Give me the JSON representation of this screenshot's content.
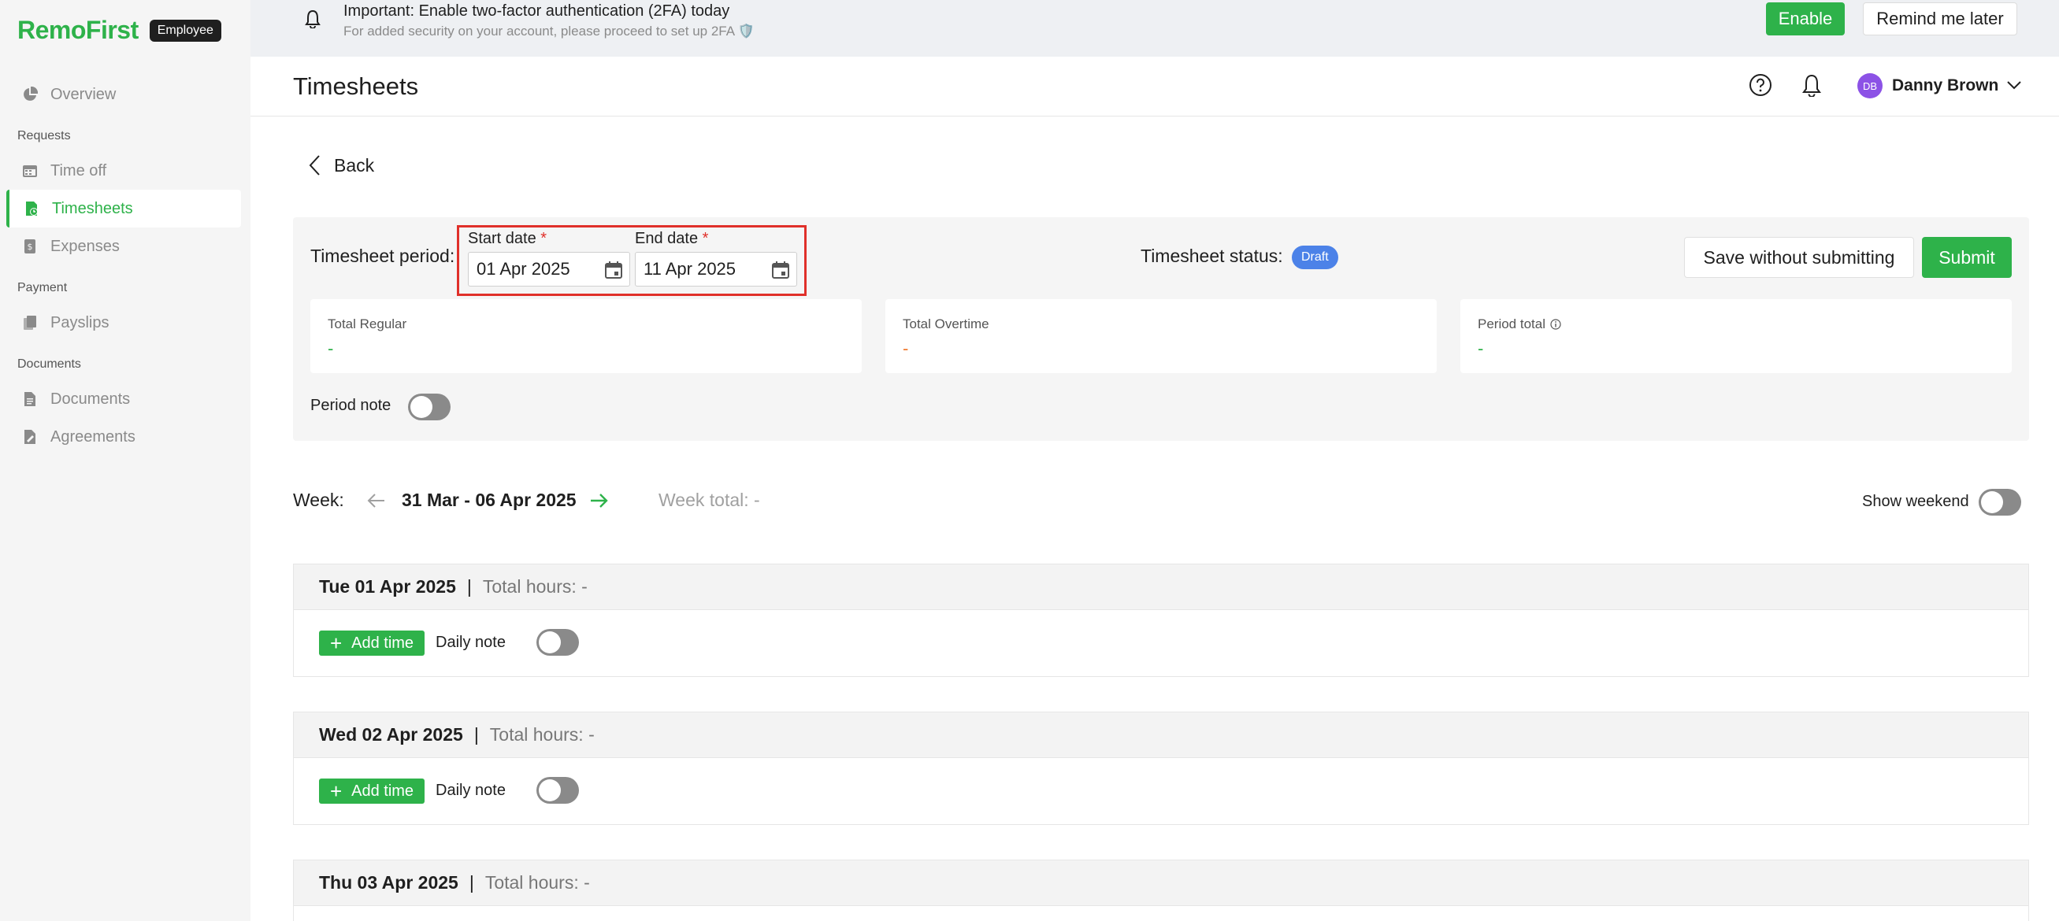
{
  "sidebar": {
    "logo": "RemoFirst",
    "badge": "Employee",
    "items": [
      {
        "label": "Overview"
      },
      {
        "section": "Requests"
      },
      {
        "label": "Time off"
      },
      {
        "label": "Timesheets",
        "active": true
      },
      {
        "label": "Expenses"
      },
      {
        "section": "Payment"
      },
      {
        "label": "Payslips"
      },
      {
        "section": "Documents"
      },
      {
        "label": "Documents"
      },
      {
        "label": "Agreements"
      }
    ]
  },
  "banner": {
    "title": "Important: Enable two-factor authentication (2FA) today",
    "subtitle": "For added security on your account, please proceed to set up 2FA 🛡️",
    "enable_label": "Enable",
    "remind_label": "Remind me later"
  },
  "header": {
    "title": "Timesheets",
    "avatar_initials": "DB",
    "user_name": "Danny Brown"
  },
  "back_label": "Back",
  "period": {
    "label": "Timesheet period:",
    "start_label": "Start date",
    "start_value": "01 Apr 2025",
    "end_label": "End date",
    "end_value": "11 Apr 2025",
    "required_mark": "*",
    "status_label": "Timesheet status:",
    "status_value": "Draft",
    "save_label": "Save without submitting",
    "submit_label": "Submit",
    "totals": [
      {
        "label": "Total Regular",
        "value": "-",
        "color": "#2eb24a"
      },
      {
        "label": "Total Overtime",
        "value": "-",
        "color": "#f07a2e"
      },
      {
        "label": "Period total",
        "value": "-",
        "color": "#2eb24a"
      }
    ],
    "note_label": "Period note"
  },
  "week": {
    "label": "Week:",
    "range": "31 Mar - 06 Apr 2025",
    "total": "Week total: -",
    "weekend_label": "Show weekend"
  },
  "days": [
    {
      "date": "Tue 01 Apr 2025",
      "total": "Total hours: -",
      "add_label": "Add time",
      "note_label": "Daily note"
    },
    {
      "date": "Wed 02 Apr 2025",
      "total": "Total hours: -",
      "add_label": "Add time",
      "note_label": "Daily note"
    },
    {
      "date": "Thu 03 Apr 2025",
      "total": "Total hours: -"
    }
  ],
  "colors": {
    "accent": "#2eb24a",
    "status": "#4c82e8",
    "highlight": "#e0302a"
  }
}
